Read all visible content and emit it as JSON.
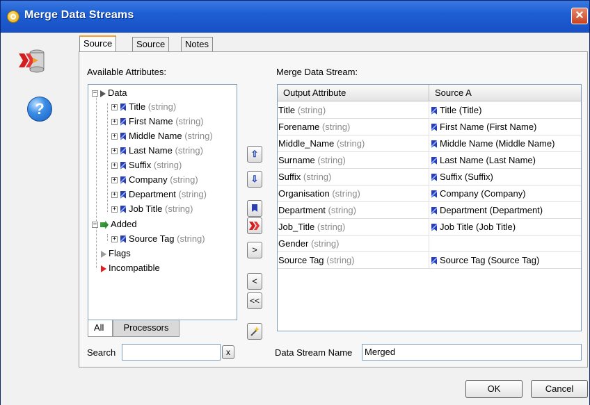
{
  "window": {
    "title": "Merge Data Streams",
    "close_label": "✕"
  },
  "tabs": [
    {
      "label": "Source A",
      "active": true
    },
    {
      "label": "Source B",
      "active": false
    },
    {
      "label": "Notes",
      "active": false
    }
  ],
  "left": {
    "label": "Available Attributes:",
    "tree": {
      "data_label": "Data",
      "data_items": [
        {
          "name": "Title",
          "type": "(string)"
        },
        {
          "name": "First Name",
          "type": "(string)"
        },
        {
          "name": "Middle Name",
          "type": "(string)"
        },
        {
          "name": "Last Name",
          "type": "(string)"
        },
        {
          "name": "Suffix",
          "type": "(string)"
        },
        {
          "name": "Company",
          "type": "(string)"
        },
        {
          "name": "Department",
          "type": "(string)"
        },
        {
          "name": "Job Title",
          "type": "(string)"
        }
      ],
      "added_label": "Added",
      "added_items": [
        {
          "name": "Source Tag",
          "type": "(string)"
        }
      ],
      "flags_label": "Flags",
      "incompatible_label": "Incompatible"
    },
    "bottom_tabs": [
      "All",
      "Processors"
    ],
    "search_label": "Search",
    "search_value": "",
    "clear_label": "x"
  },
  "middle_buttons": {
    "up": "⇧",
    "down": "⇩",
    "move_right": ">",
    "move_left": "<",
    "move_all_left": "<<"
  },
  "right": {
    "label": "Merge Data Stream:",
    "columns": [
      "Output Attribute",
      "Source A"
    ],
    "rows": [
      {
        "output": "Title",
        "type": "(string)",
        "source": "Title (Title)"
      },
      {
        "output": "Forename",
        "type": "(string)",
        "source": "First Name (First Name)"
      },
      {
        "output": "Middle_Name",
        "type": "(string)",
        "source": "Middle Name (Middle Name)"
      },
      {
        "output": "Surname",
        "type": "(string)",
        "source": "Last Name (Last Name)"
      },
      {
        "output": "Suffix",
        "type": "(string)",
        "source": "Suffix (Suffix)"
      },
      {
        "output": "Organisation",
        "type": "(string)",
        "source": "Company (Company)"
      },
      {
        "output": "Department",
        "type": "(string)",
        "source": "Department (Department)"
      },
      {
        "output": "Job_Title",
        "type": "(string)",
        "source": "Job Title (Job Title)"
      },
      {
        "output": "Gender",
        "type": "(string)",
        "source": ""
      },
      {
        "output": "Source Tag",
        "type": "(string)",
        "source": "Source Tag (Source Tag)"
      }
    ],
    "stream_name_label": "Data Stream Name",
    "stream_name_value": "Merged"
  },
  "footer": {
    "ok_label": "OK",
    "cancel_label": "Cancel"
  },
  "colors": {
    "titlebar": "#1d5fd3",
    "active_tab_accent": "#f0a030",
    "type_text": "#8a8a8a",
    "attr_icon": "#2b3fb0"
  }
}
